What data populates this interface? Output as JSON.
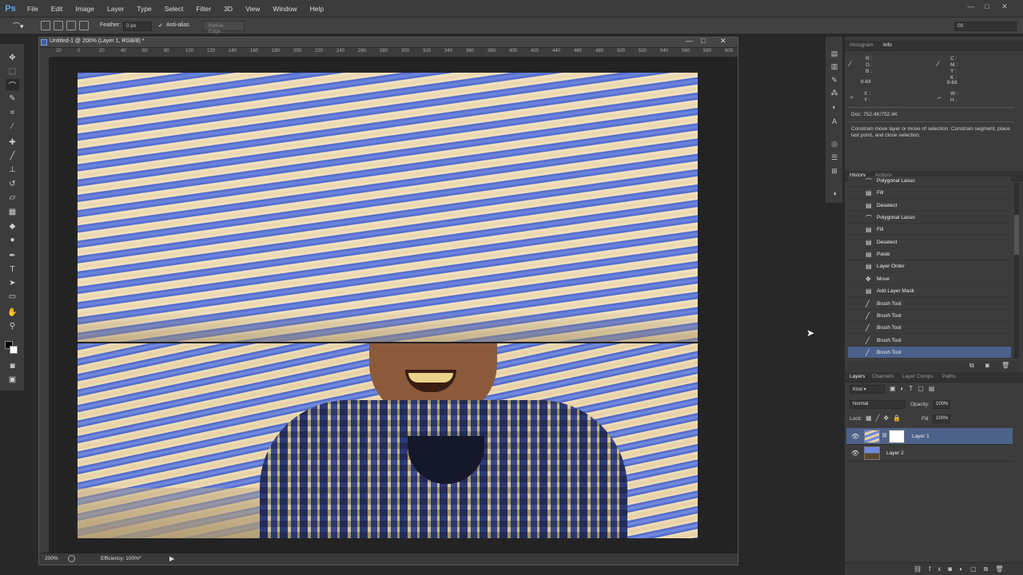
{
  "app": {
    "logo": "Ps"
  },
  "menu": [
    "File",
    "Edit",
    "Image",
    "Layer",
    "Type",
    "Select",
    "Filter",
    "3D",
    "View",
    "Window",
    "Help"
  ],
  "window_controls": {
    "minimize": "—",
    "maximize": "□",
    "close": "✕"
  },
  "options_bar": {
    "feather_label": "Feather:",
    "feather_value": "0 px",
    "anti_alias_check": "✓",
    "anti_alias_label": "Anti-alias",
    "refine_edge": "Refine Edge...",
    "workspace_value": "00"
  },
  "document": {
    "title": "Untitled-1 @ 200% (Layer 1, RGB/8) *",
    "zoom": "200%",
    "efficiency": "Efficiency: 100%*",
    "ruler_labels": [
      "20",
      "0",
      "20",
      "40",
      "60",
      "80",
      "100",
      "120",
      "140",
      "160",
      "180",
      "200",
      "220",
      "240",
      "260",
      "280",
      "300",
      "320",
      "340",
      "360",
      "380",
      "400",
      "420",
      "440",
      "460",
      "480",
      "500",
      "520",
      "540",
      "560",
      "580",
      "600"
    ]
  },
  "tools": [
    "move",
    "marquee",
    "lasso",
    "quick-select",
    "crop",
    "eyedropper",
    "healing",
    "brush",
    "stamp",
    "history-brush",
    "eraser",
    "gradient",
    "blur",
    "dodge",
    "pen",
    "type",
    "path-select",
    "shape",
    "hand",
    "zoom"
  ],
  "info_panel": {
    "tabs": [
      "Histogram",
      "Info"
    ],
    "active_tab": "Info",
    "rgb": [
      "R :",
      "G :",
      "B :"
    ],
    "cmyk": [
      "C :",
      "M :",
      "Y :",
      "K :"
    ],
    "bit_left": "8-bit",
    "bit_right": "8-bit",
    "xy": [
      "X :",
      "Y :"
    ],
    "wh": [
      "W :",
      "H :"
    ],
    "doc": "Doc: 752.4K/752.4K",
    "hint": "Constrain move layer or move of selection. Constrain segment, place last point, and close selection."
  },
  "history_panel": {
    "tabs": [
      "History",
      "Actions"
    ],
    "active_tab": "History",
    "items": [
      {
        "label": "Polygonal Lasso",
        "icon": "lasso-icon"
      },
      {
        "label": "Fill",
        "icon": "fill-icon"
      },
      {
        "label": "Deselect",
        "icon": "deselect-icon"
      },
      {
        "label": "Polygonal Lasso",
        "icon": "lasso-icon"
      },
      {
        "label": "Fill",
        "icon": "fill-icon"
      },
      {
        "label": "Deselect",
        "icon": "deselect-icon"
      },
      {
        "label": "Paste",
        "icon": "paste-icon"
      },
      {
        "label": "Layer Order",
        "icon": "layer-order-icon"
      },
      {
        "label": "Move",
        "icon": "move-icon"
      },
      {
        "label": "Add Layer Mask",
        "icon": "mask-icon"
      },
      {
        "label": "Brush Tool",
        "icon": "brush-icon"
      },
      {
        "label": "Brush Tool",
        "icon": "brush-icon"
      },
      {
        "label": "Brush Tool",
        "icon": "brush-icon"
      },
      {
        "label": "Brush Tool",
        "icon": "brush-icon"
      },
      {
        "label": "Brush Tool",
        "icon": "brush-icon"
      }
    ]
  },
  "layers_panel": {
    "tabs": [
      "Layers",
      "Channels",
      "Layer Comps",
      "Paths"
    ],
    "active_tab": "Layers",
    "kind": "Kind",
    "blend_mode": "Normal",
    "opacity_label": "Opacity:",
    "opacity_value": "100%",
    "lock_label": "Lock:",
    "fill_label": "Fill:",
    "fill_value": "100%",
    "layers": [
      {
        "name": "Layer 1",
        "selected": true
      },
      {
        "name": "Layer 2",
        "selected": false
      }
    ]
  },
  "colors": {
    "accent": "#4d6289",
    "history_selected": "#4b6189",
    "stripe_blue": "#4e66c8",
    "stripe_cream": "#f3e6c4"
  }
}
